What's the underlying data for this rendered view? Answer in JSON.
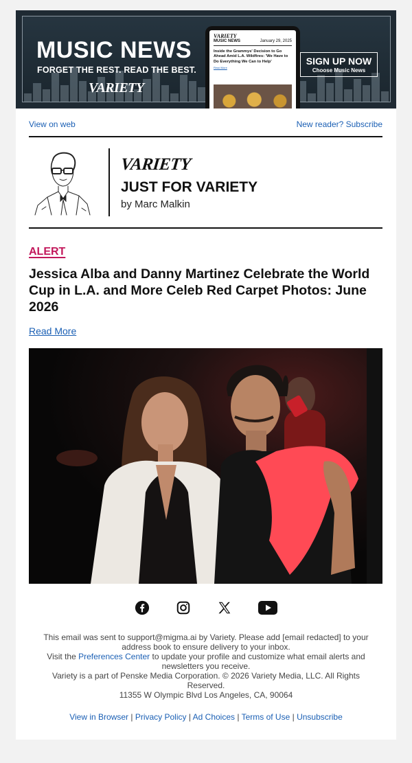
{
  "banner": {
    "title": "MUSIC NEWS",
    "tagline": "FORGET THE REST. READ THE BEST.",
    "logo": "VARIETY",
    "tablet": {
      "logo": "VARIETY",
      "section": "MUSIC NEWS",
      "date": "January 29, 2025",
      "headline": "Inside the Grammys' Decision to Go Ahead Amid L.A. Wildfires: 'We Have to Do Everything We Can to Help'",
      "link": "Read More"
    },
    "signup": {
      "label": "SIGN UP NOW",
      "sublabel": "Choose Music News"
    }
  },
  "toplinks": {
    "view_on_web": "View on web",
    "subscribe": "New reader? Subscribe"
  },
  "column": {
    "logo": "VARIETY",
    "title": "JUST FOR VARIETY",
    "byline": "by Marc Malkin"
  },
  "article": {
    "label": "ALERT",
    "headline": "Jessica Alba and Danny Martinez Celebrate the World Cup in L.A. and More Celeb Red Carpet Photos: June 2026",
    "read_more": "Read More"
  },
  "social": [
    "facebook-icon",
    "instagram-icon",
    "x-icon",
    "youtube-icon"
  ],
  "footer": {
    "line1": "This email was sent to support@migma.ai by Variety. Please add [email redacted] to your address book to ensure delivery to your inbox.",
    "visit": "Visit the",
    "preferences": "Preferences Center",
    "visit_rest": "to update your profile and customize what email alerts and newsletters you receive.",
    "copyright": "Variety is a part of Penske Media Corporation. © 2026 Variety Media, LLC. All Rights Reserved.",
    "address": "11355 W Olympic Blvd Los Angeles, CA, 90064",
    "links": [
      "View in Browser",
      "Privacy Policy",
      "Ad Choices",
      "Terms of Use",
      "Unsubscribe"
    ]
  },
  "colors": {
    "accent": "#c2185b",
    "link": "#1a5fb4",
    "banner_bg": "#1f2a33"
  }
}
